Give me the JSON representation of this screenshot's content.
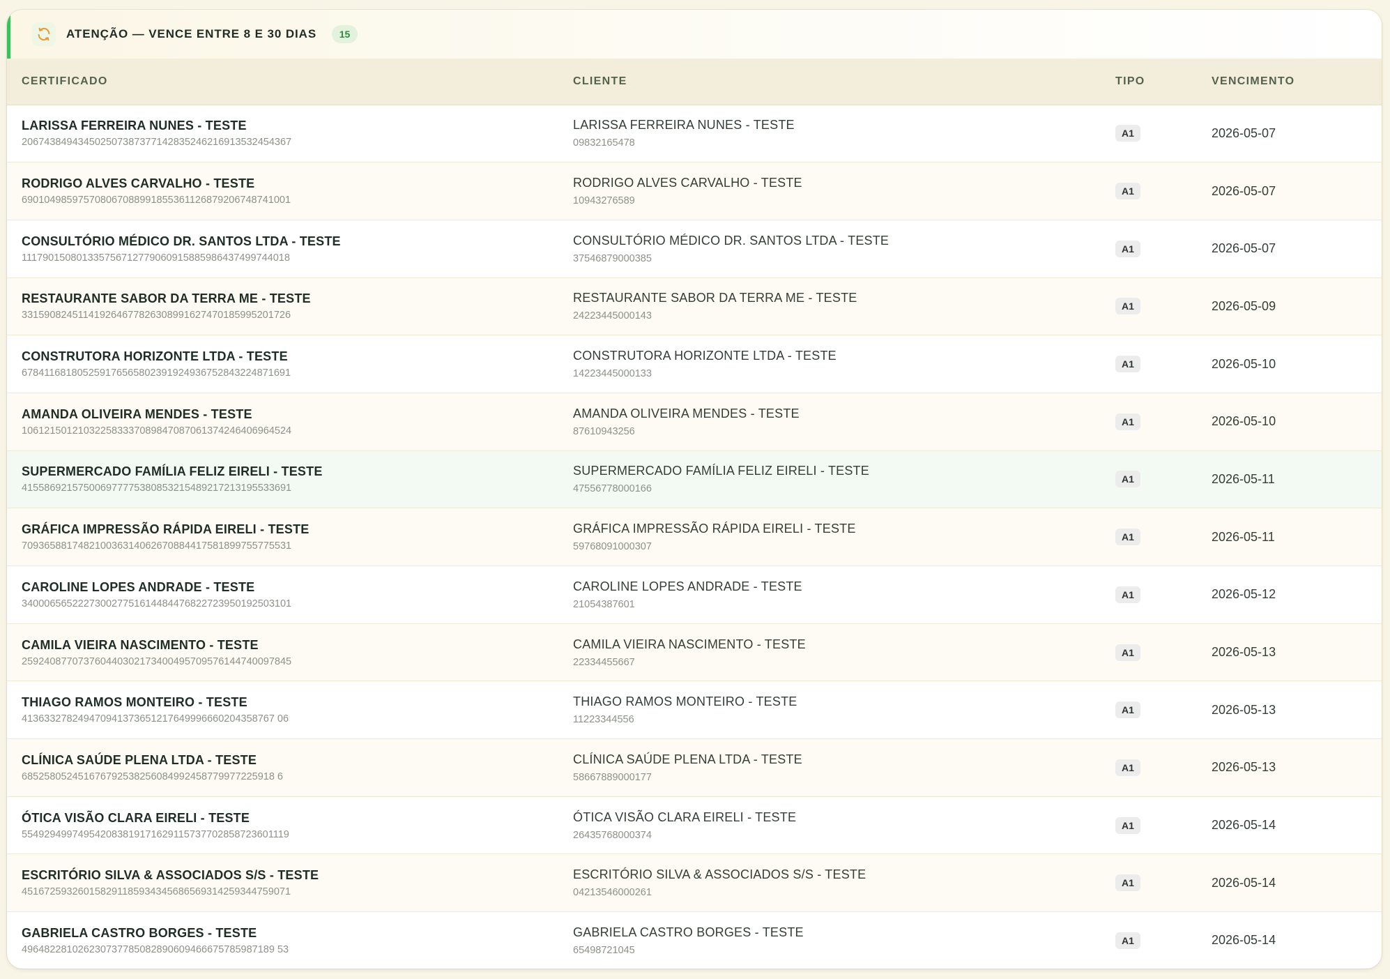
{
  "header": {
    "title": "ATENÇÃO — VENCE ENTRE 8 E 30 DIAS",
    "count": "15"
  },
  "columns": {
    "certificado": "CERTIFICADO",
    "cliente": "CLIENTE",
    "tipo": "TIPO",
    "vencimento": "VENCIMENTO"
  },
  "rows": [
    {
      "cert_name": "LARISSA FERREIRA NUNES - TESTE",
      "serial": "206743849434502507387377142835246216913532454367",
      "client_name": "LARISSA FERREIRA NUNES - TESTE",
      "client_doc": "09832165478",
      "tipo": "A1",
      "vencimento": "2026-05-07"
    },
    {
      "cert_name": "RODRIGO ALVES CARVALHO - TESTE",
      "serial": "690104985975708067088991855361126879206748741001",
      "client_name": "RODRIGO ALVES CARVALHO - TESTE",
      "client_doc": "10943276589",
      "tipo": "A1",
      "vencimento": "2026-05-07"
    },
    {
      "cert_name": "CONSULTÓRIO MÉDICO DR. SANTOS LTDA - TESTE",
      "serial": "111790150801335756712779060915885986437499744018",
      "client_name": "CONSULTÓRIO MÉDICO DR. SANTOS LTDA - TESTE",
      "client_doc": "37546879000385",
      "tipo": "A1",
      "vencimento": "2026-05-07"
    },
    {
      "cert_name": "RESTAURANTE SABOR DA TERRA ME - TESTE",
      "serial": "331590824511419264677826308991627470185995201726",
      "client_name": "RESTAURANTE SABOR DA TERRA ME - TESTE",
      "client_doc": "24223445000143",
      "tipo": "A1",
      "vencimento": "2026-05-09"
    },
    {
      "cert_name": "CONSTRUTORA HORIZONTE LTDA - TESTE",
      "serial": "678411681805259176565802391924936752843224871691",
      "client_name": "CONSTRUTORA HORIZONTE LTDA - TESTE",
      "client_doc": "14223445000133",
      "tipo": "A1",
      "vencimento": "2026-05-10"
    },
    {
      "cert_name": "AMANDA OLIVEIRA MENDES - TESTE",
      "serial": "106121501210322583337089847087061374246406964524",
      "client_name": "AMANDA OLIVEIRA MENDES - TESTE",
      "client_doc": "87610943256",
      "tipo": "A1",
      "vencimento": "2026-05-10"
    },
    {
      "cert_name": "SUPERMERCADO FAMÍLIA FELIZ EIRELI - TESTE",
      "serial": "415586921575006977775380853215489217213195533691",
      "client_name": "SUPERMERCADO FAMÍLIA FELIZ EIRELI - TESTE",
      "client_doc": "47556778000166",
      "tipo": "A1",
      "vencimento": "2026-05-11"
    },
    {
      "cert_name": "GRÁFICA IMPRESSÃO RÁPIDA EIRELI - TESTE",
      "serial": "709365881748210036314062670884417581899755775531",
      "client_name": "GRÁFICA IMPRESSÃO RÁPIDA EIRELI - TESTE",
      "client_doc": "59768091000307",
      "tipo": "A1",
      "vencimento": "2026-05-11"
    },
    {
      "cert_name": "CAROLINE LOPES ANDRADE - TESTE",
      "serial": "340006565222730027751614484476822723950192503101",
      "client_name": "CAROLINE LOPES ANDRADE - TESTE",
      "client_doc": "21054387601",
      "tipo": "A1",
      "vencimento": "2026-05-12"
    },
    {
      "cert_name": "CAMILA VIEIRA NASCIMENTO - TESTE",
      "serial": "259240877073760440302173400495709576144740097845",
      "client_name": "CAMILA VIEIRA NASCIMENTO - TESTE",
      "client_doc": "22334455667",
      "tipo": "A1",
      "vencimento": "2026-05-13"
    },
    {
      "cert_name": "THIAGO RAMOS MONTEIRO - TESTE",
      "serial": "413633278249470941373651217649996660204358767 06",
      "client_name": "THIAGO RAMOS MONTEIRO - TESTE",
      "client_doc": "11223344556",
      "tipo": "A1",
      "vencimento": "2026-05-13"
    },
    {
      "cert_name": "CLÍNICA SAÚDE PLENA LTDA - TESTE",
      "serial": "685258052451676792538256084992458779977225918 6",
      "client_name": "CLÍNICA SAÚDE PLENA LTDA - TESTE",
      "client_doc": "58667889000177",
      "tipo": "A1",
      "vencimento": "2026-05-13"
    },
    {
      "cert_name": "ÓTICA VISÃO CLARA EIRELI - TESTE",
      "serial": "554929499749542083819171629115737702858723601119",
      "client_name": "ÓTICA VISÃO CLARA EIRELI - TESTE",
      "client_doc": "26435768000374",
      "tipo": "A1",
      "vencimento": "2026-05-14"
    },
    {
      "cert_name": "ESCRITÓRIO SILVA & ASSOCIADOS S/S - TESTE",
      "serial": "451672593260158291185934345686569314259344759071",
      "client_name": "ESCRITÓRIO SILVA & ASSOCIADOS S/S - TESTE",
      "client_doc": "04213546000261",
      "tipo": "A1",
      "vencimento": "2026-05-14"
    },
    {
      "cert_name": "GABRIELA CASTRO BORGES - TESTE",
      "serial": "496482281026230737785082890609466675785987189 53",
      "client_name": "GABRIELA CASTRO BORGES - TESTE",
      "client_doc": "65498721045",
      "tipo": "A1",
      "vencimento": "2026-05-14"
    }
  ]
}
